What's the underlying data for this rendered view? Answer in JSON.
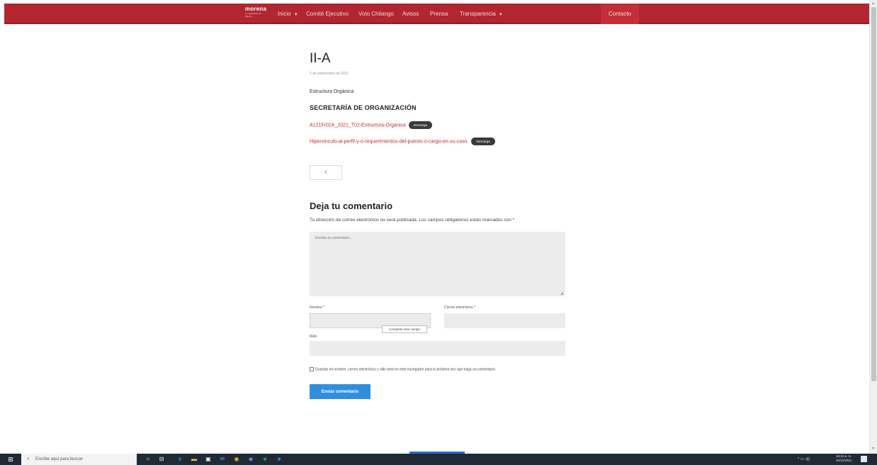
{
  "nav": {
    "logo_line1": "morena",
    "logo_line2": "La esperanza de México",
    "items": [
      {
        "label": "Inicio",
        "dropdown": true
      },
      {
        "label": "Comité Ejecutivo",
        "dropdown": false
      },
      {
        "label": "Voto Chilango",
        "dropdown": false
      },
      {
        "label": "Avisos",
        "dropdown": false
      },
      {
        "label": "Prensa",
        "dropdown": false
      },
      {
        "label": "Transparencia",
        "dropdown": true
      }
    ],
    "caret": "▼",
    "contact": "Contacto"
  },
  "post": {
    "title": "II-A",
    "date": "5 de septiembre de 2021",
    "subtitle": "Estructura Orgánica",
    "heading": "SECRETARÍA DE ORGANIZACIÓN",
    "documents": [
      {
        "link": "A121Fr02A_2021_T02-Estructura-Organica",
        "badge": "Descarga"
      },
      {
        "link": "Hipervinculo-al-perfil-y-o-requerimientos-del-puesto-o-cargo-en-su-caso.",
        "badge": "Descarga"
      }
    ],
    "back_symbol": "‹"
  },
  "comments": {
    "title": "Deja tu comentario",
    "notice": "Tu dirección de correo electrónico no será publicada. Los campos obligatorios están marcados con *",
    "textarea_placeholder": "Escribe tu comentario...",
    "name_label": "Nombre *",
    "email_label": "Correo electrónico *",
    "web_label": "Web",
    "tooltip": "Completa este campo",
    "save_label": "Guardar mi nombre, correo electrónico y sitio web en este navegador para la próxima vez que haga un comentario.",
    "submit_label": "Enviar comentario"
  },
  "taskbar": {
    "start_icon": "windows-logo-icon",
    "search_placeholder": "Escribe aquí para buscar",
    "search_icon": "⌕",
    "apps": [
      {
        "icon": "cortana-icon",
        "glyph": "○",
        "color": "#ffffff"
      },
      {
        "icon": "task-view-icon",
        "glyph": "⊟",
        "color": "#ffffff"
      },
      {
        "icon": "edge-icon",
        "glyph": "e",
        "color": "#2f8fdd"
      },
      {
        "icon": "file-explorer-icon",
        "glyph": "▬",
        "color": "#f2c94c"
      },
      {
        "icon": "store-icon",
        "glyph": "▣",
        "color": "#ffffff"
      },
      {
        "icon": "mail-icon",
        "glyph": "✉",
        "color": "#4aa3f0"
      },
      {
        "icon": "chrome-icon",
        "glyph": "◉",
        "color": "#f2b233"
      },
      {
        "icon": "teams-icon",
        "glyph": "◆",
        "color": "#7b83eb"
      },
      {
        "icon": "excel-icon",
        "glyph": "■",
        "color": "#1f9a55"
      },
      {
        "icon": "word-icon",
        "glyph": "■",
        "color": "#3a78d4"
      }
    ],
    "tray": "^ ▭ ◁))",
    "time": "10:43 a. m.",
    "date": "02/11/2021"
  },
  "colors": {
    "brand": "#b32630",
    "link": "#c1272d",
    "submit": "#2f8fdd"
  }
}
